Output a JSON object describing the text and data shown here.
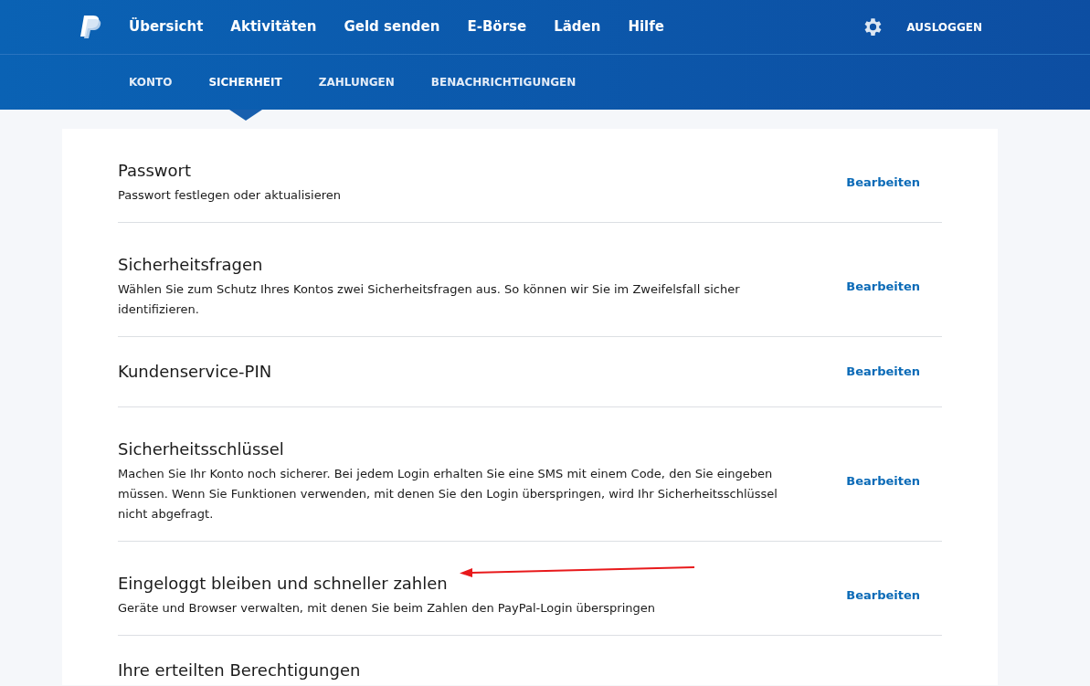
{
  "top_nav": {
    "items": [
      "Übersicht",
      "Aktivitäten",
      "Geld senden",
      "E-Börse",
      "Läden",
      "Hilfe"
    ],
    "logout": "AUSLOGGEN"
  },
  "sub_nav": [
    {
      "label": "KONTO",
      "selected": false
    },
    {
      "label": "SICHERHEIT",
      "selected": true
    },
    {
      "label": "ZAHLUNGEN",
      "selected": false
    },
    {
      "label": "BENACHRICHTIGUNGEN",
      "selected": false
    }
  ],
  "settings": [
    {
      "title": "Passwort",
      "description": "Passwort festlegen oder aktualisieren",
      "action": "Bearbeiten"
    },
    {
      "title": "Sicherheitsfragen",
      "description": "Wählen Sie zum Schutz Ihres Kontos zwei Sicherheitsfragen aus. So können wir Sie im Zweifelsfall sicher identifizieren.",
      "action": "Bearbeiten"
    },
    {
      "title": "Kundenservice-PIN",
      "action": "Bearbeiten"
    },
    {
      "title": "Sicherheitsschlüssel",
      "description": "Machen Sie Ihr Konto noch sicherer. Bei jedem Login erhalten Sie eine SMS mit einem Code, den Sie eingeben müssen. Wenn Sie Funktionen verwenden, mit denen Sie den Login überspringen, wird Ihr Sicherheitsschlüssel nicht abgefragt.",
      "action": "Bearbeiten"
    },
    {
      "title": "Eingeloggt bleiben und schneller zahlen",
      "description": "Geräte und Browser verwalten, mit denen Sie beim Zahlen den PayPal-Login überspringen",
      "action": "Bearbeiten"
    },
    {
      "title": "Ihre erteilten Berechtigungen"
    }
  ]
}
